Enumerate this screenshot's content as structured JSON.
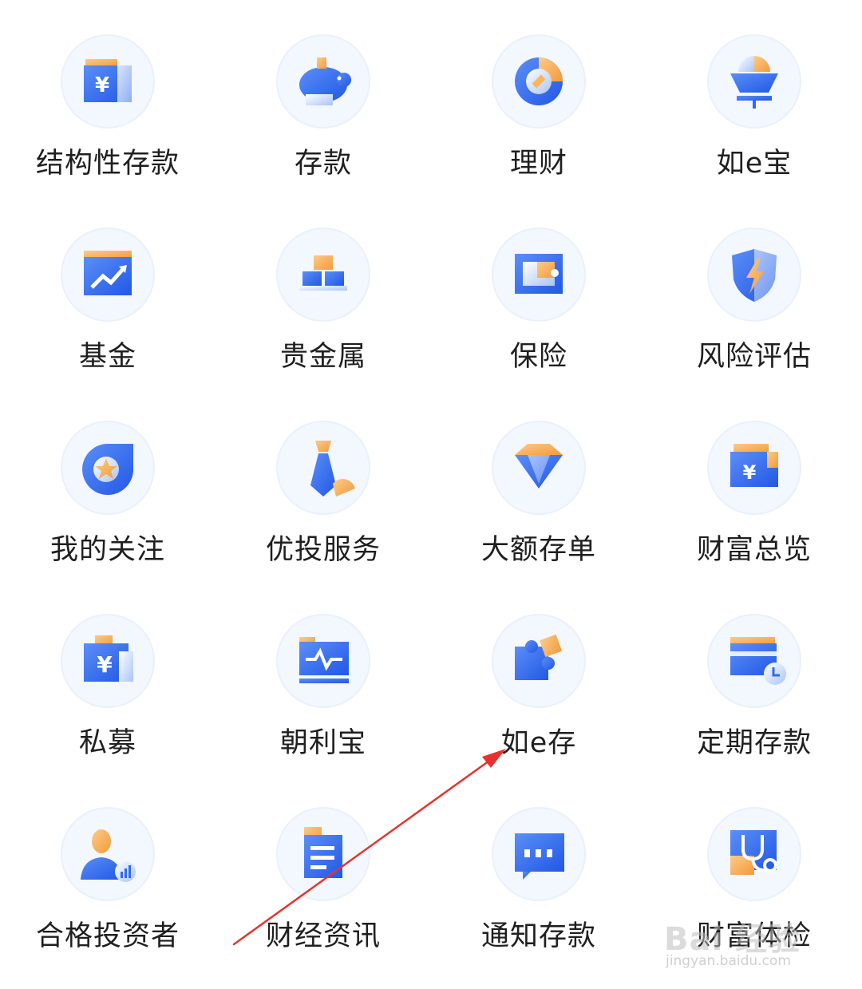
{
  "colors": {
    "blue": "#2F6BF0",
    "light_blue": "#8FB3F7",
    "orange": "#F7A955",
    "circle_bg": "#F3F7FE",
    "label": "#1F1F1F",
    "arrow": "#E8322E"
  },
  "grid": {
    "items": [
      {
        "label": "结构性存款",
        "icon": "structured-deposit-icon"
      },
      {
        "label": "存款",
        "icon": "piggy-bank-icon"
      },
      {
        "label": "理财",
        "icon": "pie-chart-icon"
      },
      {
        "label": "如e宝",
        "icon": "treasure-bowl-icon"
      },
      {
        "label": "基金",
        "icon": "fund-chart-icon"
      },
      {
        "label": "贵金属",
        "icon": "gold-bars-icon"
      },
      {
        "label": "保险",
        "icon": "insurance-box-icon"
      },
      {
        "label": "风险评估",
        "icon": "shield-bolt-icon"
      },
      {
        "label": "我的关注",
        "icon": "star-follow-icon"
      },
      {
        "label": "优投服务",
        "icon": "tie-icon"
      },
      {
        "label": "大额存单",
        "icon": "diamond-icon"
      },
      {
        "label": "财富总览",
        "icon": "wealth-overview-icon"
      },
      {
        "label": "私募",
        "icon": "private-fund-icon"
      },
      {
        "label": "朝利宝",
        "icon": "monitor-pulse-icon"
      },
      {
        "label": "如e存",
        "icon": "puzzle-icon"
      },
      {
        "label": "定期存款",
        "icon": "time-deposit-card-icon"
      },
      {
        "label": "合格投资者",
        "icon": "investor-person-icon"
      },
      {
        "label": "财经资讯",
        "icon": "news-document-icon"
      },
      {
        "label": "通知存款",
        "icon": "notice-message-icon"
      },
      {
        "label": "财富体检",
        "icon": "stethoscope-icon"
      }
    ]
  },
  "watermark": {
    "main": "Bai 经验",
    "sub": "jingyan.baidu.com"
  }
}
